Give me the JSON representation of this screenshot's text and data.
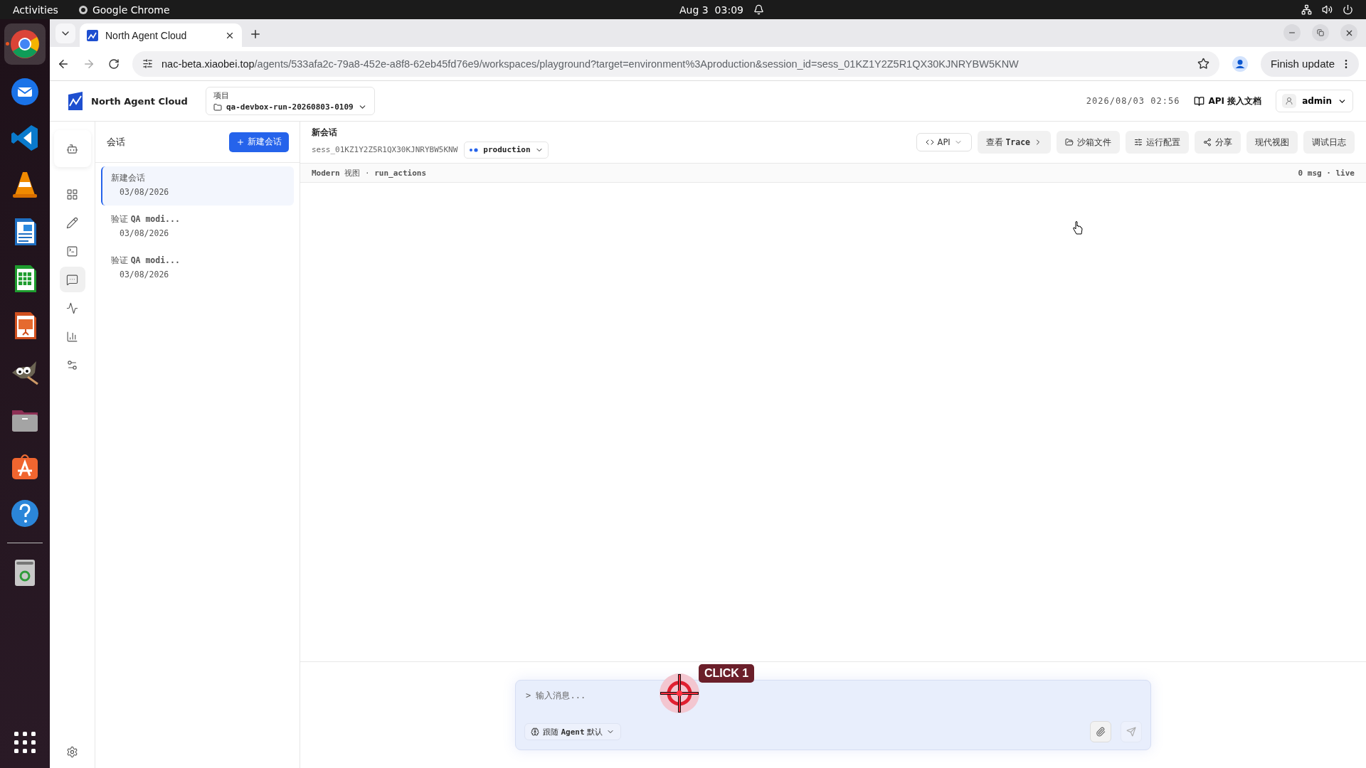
{
  "system_bar": {
    "activities": "Activities",
    "app": "Google Chrome",
    "clock": "Aug 3  03:09"
  },
  "dock": {
    "apps": [
      {
        "kind": "browser",
        "selected": true
      },
      {
        "kind": "mail",
        "selected": false
      },
      {
        "kind": "code",
        "selected": false
      },
      {
        "kind": "cone",
        "selected": false
      },
      {
        "kind": "writer",
        "selected": false
      },
      {
        "kind": "calc",
        "selected": false
      },
      {
        "kind": "impress",
        "selected": false
      },
      {
        "kind": "gimp",
        "selected": false
      },
      {
        "kind": "files",
        "selected": false
      },
      {
        "kind": "store",
        "selected": false
      },
      {
        "kind": "help",
        "selected": false
      },
      {
        "kind": "trash",
        "selected": false
      }
    ]
  },
  "browser": {
    "tabs": [
      {
        "title": "North Agent Cloud",
        "selected": true
      }
    ],
    "url_host": "nac-beta.xiaobei.top",
    "url_path": "/agents/533afa2c-79a8-452e-a8f8-62eb45fd76e9/workspaces/playground?target=environment%3Aproduction&session_id=sess_01KZ1Y2Z5R1QX30KJNRYBW5KNW",
    "update_button": "Finish update"
  },
  "header": {
    "brand": "North Agent Cloud",
    "project_label": "项目",
    "project": "qa-devbox-run-20260803-0109",
    "timestamp": "2026/08/03 02:56",
    "docs_link": "API 接入文档",
    "user": "admin"
  },
  "rail": {
    "items": [
      {
        "kind": "bot",
        "selected": false
      },
      {
        "kind": "grid",
        "selected": false
      },
      {
        "kind": "edit",
        "selected": false
      },
      {
        "kind": "terminal",
        "selected": false
      },
      {
        "kind": "chat",
        "selected": true
      },
      {
        "kind": "activity",
        "selected": false
      },
      {
        "kind": "chart",
        "selected": false
      },
      {
        "kind": "sliders",
        "selected": false
      }
    ]
  },
  "sessions": {
    "title": "会话",
    "new_button": "新建会话",
    "items": [
      {
        "title": "新建会话",
        "date": "03/08/2026",
        "selected": true
      },
      {
        "title": "验证 **QA modi...**",
        "date": "03/08/2026",
        "selected": false
      },
      {
        "title": "验证 **QA modi...**",
        "date": "03/08/2026",
        "selected": false
      }
    ]
  },
  "conversation": {
    "title": "新会话",
    "session_id": "sess_01KZ1Y2Z5R1QX30KJNRYBW5KNW",
    "environment": "production",
    "actions": [
      {
        "kind": "api",
        "label": "API"
      },
      {
        "kind": "trace",
        "label": "查看 **Trace**"
      },
      {
        "kind": "files",
        "label": "沙箱文件"
      },
      {
        "kind": "config",
        "label": "运行配置"
      },
      {
        "kind": "share",
        "label": "分享"
      },
      {
        "kind": "plain",
        "label": "现代视图"
      },
      {
        "kind": "plain",
        "label": "调试日志"
      }
    ]
  },
  "view_bar": {
    "left": "**Modern** 视图 · **run_actions**",
    "right": "0 msg · live"
  },
  "composer": {
    "placeholder": "> 输入消息...",
    "mode": "跟随 **Agent** 默认"
  },
  "click_marker": {
    "label": "CLICK 1"
  }
}
